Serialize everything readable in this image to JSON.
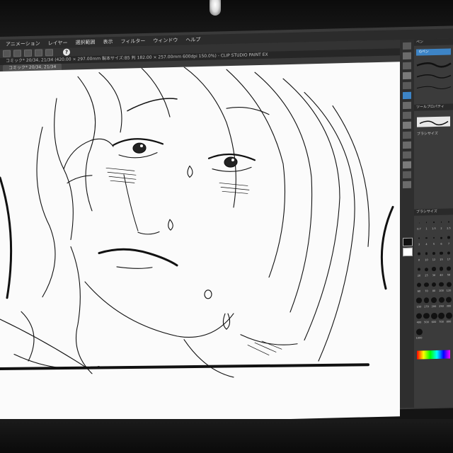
{
  "window": {
    "title": "コミック* 20/34, 21/34 (420.00 × 297.00mm 製本サイズ:B5 判 182.00 × 257.00mm 600dpi 150.0%) - CLIP STUDIO PAINT EX",
    "tab_label": "コミック* 20/34, 21/34",
    "help_label": "?"
  },
  "menubar": {
    "items": [
      {
        "label": "アニメーション"
      },
      {
        "label": "レイヤー"
      },
      {
        "label": "選択範囲"
      },
      {
        "label": "表示"
      },
      {
        "label": "フィルター"
      },
      {
        "label": "ウィンドウ"
      },
      {
        "label": "ヘルプ"
      }
    ]
  },
  "right_panel": {
    "sub_tool_header": "ペン",
    "selected_tool": "Gペン",
    "tool_property_header": "ツールプロパティ",
    "brush_size_label": "ブラシサイズ",
    "brush_size_header": "ブラシサイズ",
    "brush_sizes": [
      "0.7",
      "1",
      "1.5",
      "2",
      "2.5",
      "3",
      "4",
      "5",
      "6",
      "7",
      "8",
      "10",
      "12",
      "15",
      "17",
      "20",
      "25",
      "30",
      "40",
      "50",
      "60",
      "70",
      "80",
      "100",
      "120",
      "150",
      "170",
      "200",
      "250",
      "300",
      "400",
      "500",
      "600",
      "700",
      "800",
      "1000"
    ]
  },
  "colors": {
    "canvas": "#fbfbfb",
    "ui_dark": "#2b2b2b",
    "accent": "#3d84c6"
  }
}
